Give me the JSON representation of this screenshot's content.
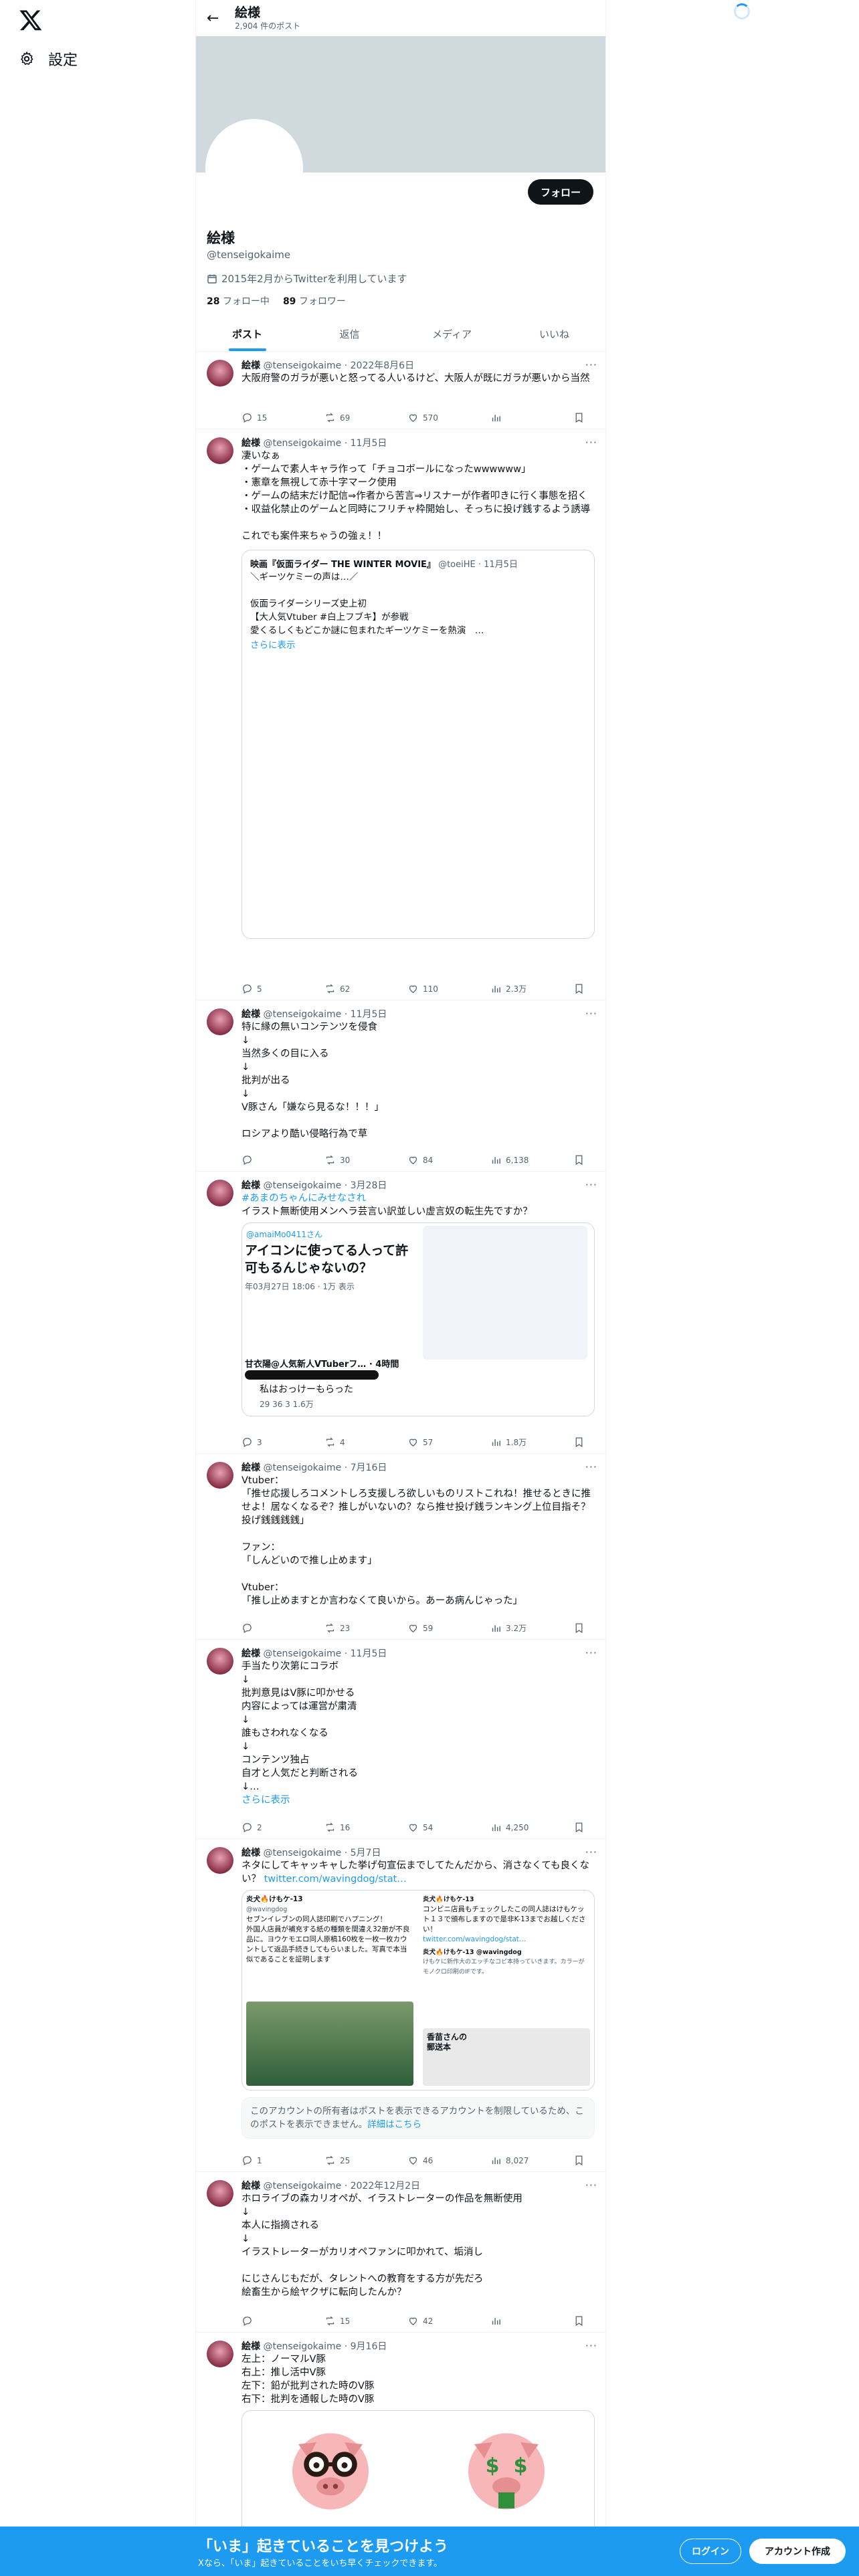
{
  "nav": {
    "settings_label": "設定",
    "logo_icon": "x-logo-icon",
    "settings_icon": "gear-icon"
  },
  "header": {
    "name": "絵様",
    "post_count": "2,904 件のポスト"
  },
  "profile": {
    "name": "絵様",
    "handle": "@tenseigokaime",
    "joined": "2015年2月からTwitterを利用しています",
    "following_num": "28",
    "following_label": "フォロー中",
    "followers_num": "89",
    "followers_label": "フォロワー",
    "follow_button": "フォロー"
  },
  "tabs": [
    "ポスト",
    "返信",
    "メディア",
    "いいね"
  ],
  "tweets": [
    {
      "name": "絵様",
      "handle": "@tenseigokaime",
      "date": "2022年8月6日",
      "text": "大阪府警のガラが悪いと怒ってる人いるけど、大阪人が既にガラが悪いから当然",
      "reply": "15",
      "retweet": "69",
      "like": "570",
      "views": ""
    },
    {
      "name": "絵様",
      "handle": "@tenseigokaime",
      "date": "11月5日",
      "text": "凄いなぁ\n・ゲームで素人キャラ作って「チョコボールになったwwwwww」\n・憲章を無視して赤十字マーク使用\n・ゲームの結末だけ配信⇒作者から苦言⇒リスナーが作者叩きに行く事態を招く\n・収益化禁止のゲームと同時にフリチャ枠開始し、そっちに投げ銭するよう誘導\n\nこれでも案件来ちゃうの強ぇ！！",
      "quote_name": "映画『仮面ライダー THE WINTER MOVIE』",
      "quote_handle": "@toeiHE",
      "quote_date": "11月5日",
      "quote_text": "＼ギーツケミーの声は…／\n\n仮面ライダーシリーズ史上初\n【大人気Vtuber #白上フブキ】が参戦\n愛くるしくもどこか謎に包まれたギーツケミーを熱演　…",
      "quote_more": "さらに表示",
      "reply": "5",
      "retweet": "62",
      "like": "110",
      "views": "2.3万"
    },
    {
      "name": "絵様",
      "handle": "@tenseigokaime",
      "date": "11月5日",
      "text": "特に縁の無いコンテンツを侵食\n↓\n当然多くの目に入る\n↓\n批判が出る\n↓\nV豚さん「嫌なら見るな！！！」\n\nロシアより酷い侵略行為で草",
      "reply": "",
      "retweet": "30",
      "like": "84",
      "views": "6,138"
    },
    {
      "name": "絵様",
      "handle": "@tenseigokaime",
      "date": "3月28日",
      "text_tag": "#あまのちゃんにみせなされ",
      "text": "イラスト無断使用メンヘラ芸言い訳並しい虚言奴の転生先ですか？",
      "img_handle": "@amaiMo0411さん",
      "img_title": "アイコンに使ってる人って許可もるんじゃないの？",
      "img_date": "年03月27日 18:06 · 1万 表示",
      "img_caption": "甘衣陽@人気新人VTuberフ… · 4時間",
      "img_text": "私はおっけーもらった",
      "img_stats": "29  36  3  1.6万",
      "reply": "3",
      "retweet": "4",
      "like": "57",
      "views": "1.8万"
    },
    {
      "name": "絵様",
      "handle": "@tenseigokaime",
      "date": "7月16日",
      "text": "Vtuber：\n「推せ応援しろコメントしろ支援しろ欲しいものリストこれね！推せるときに推せよ！居なくなるぞ？推しがいないの？なら推せ投げ銭ランキング上位目指そ？投げ銭銭銭銭」\n\nファン：\n「しんどいので推し止めます」\n\nVtuber：\n「推し止めますとか言わなくて良いから。あーあ病んじゃった」",
      "reply": "",
      "retweet": "23",
      "like": "59",
      "views": "3.2万"
    },
    {
      "name": "絵様",
      "handle": "@tenseigokaime",
      "date": "11月5日",
      "text": "手当たり次第にコラボ\n↓\n批判意見はV豚に叩かせる\n内容によっては運営が粛清\n↓\n誰もさわれなくなる\n↓\nコンテンツ独占\n自才と人気だと判断される\n↓…",
      "more": "さらに表示",
      "reply": "2",
      "retweet": "16",
      "like": "54",
      "views": "4,250"
    },
    {
      "name": "絵様",
      "handle": "@tenseigokaime",
      "date": "5月7日",
      "text": "ネタにしてキャッキャした挙げ句宣伝までしてたんだから、消さなくても良くない？ ",
      "text_link": "twitter.com/wavingdog/stat…",
      "img1_name": "炎犬🔥けもケ-13",
      "img1_handle": "@wavingdog",
      "img1_text": "セブンイレブンの同人誌印刷でハプニング！\n外国人店員が補充する紙の種類を間違え32册が不良品に。ヨウケモエロ同人原稿160枚を一枚一枚カウントして返品手続きしてもらいました。写真で本当似であることを証明します",
      "img2_name": "炎犬🔥けもケ-13",
      "img2_text": "コンビニ店員もチェックしたこの同人誌はけもケット１３で頒布しますので是非K-13までお越しください！",
      "img2_link": "twitter.com/wavingdog/stat…",
      "img2_sub": "炎犬🔥けもケ-13 @wavingdog",
      "img2_small": "けもケに新作大のエッチなコピ本持っていきます。カラーがモノクロ印刷のIFです。",
      "img2_caption": "香苗さんの\n郵送本",
      "notice": "このアカウントの所有者はポストを表示できるアカウントを制限しているため、このポストを表示できません。",
      "notice_link": "詳細はこちら",
      "reply": "1",
      "retweet": "25",
      "like": "46",
      "views": "8,027"
    },
    {
      "name": "絵様",
      "handle": "@tenseigokaime",
      "date": "2022年12月2日",
      "text": "ホロライブの森カリオペが、イラストレーターの作品を無断使用\n↓\n本人に指摘される\n↓\nイラストレーターがカリオペファンに叩かれて、垢消し\n\nにじさんじもだが、タレントへの教育をする方が先だろ\n絵畜生から絵ヤクザに転向したんか？",
      "reply": "",
      "retweet": "15",
      "like": "42",
      "views": ""
    },
    {
      "name": "絵様",
      "handle": "@tenseigokaime",
      "date": "9月16日",
      "text": "左上：ノーマルV豚\n右上：推し活中V豚\n左下：鉛が批判された時のV豚\n右下：批判を通報した時のV豚"
    }
  ],
  "footer": {
    "title": "「いま」起きていることを見つけよう",
    "subtitle": "Xなら、「いま」起きていることをいち早くチェックできます。",
    "login": "ログイン",
    "signup": "アカウント作成"
  }
}
